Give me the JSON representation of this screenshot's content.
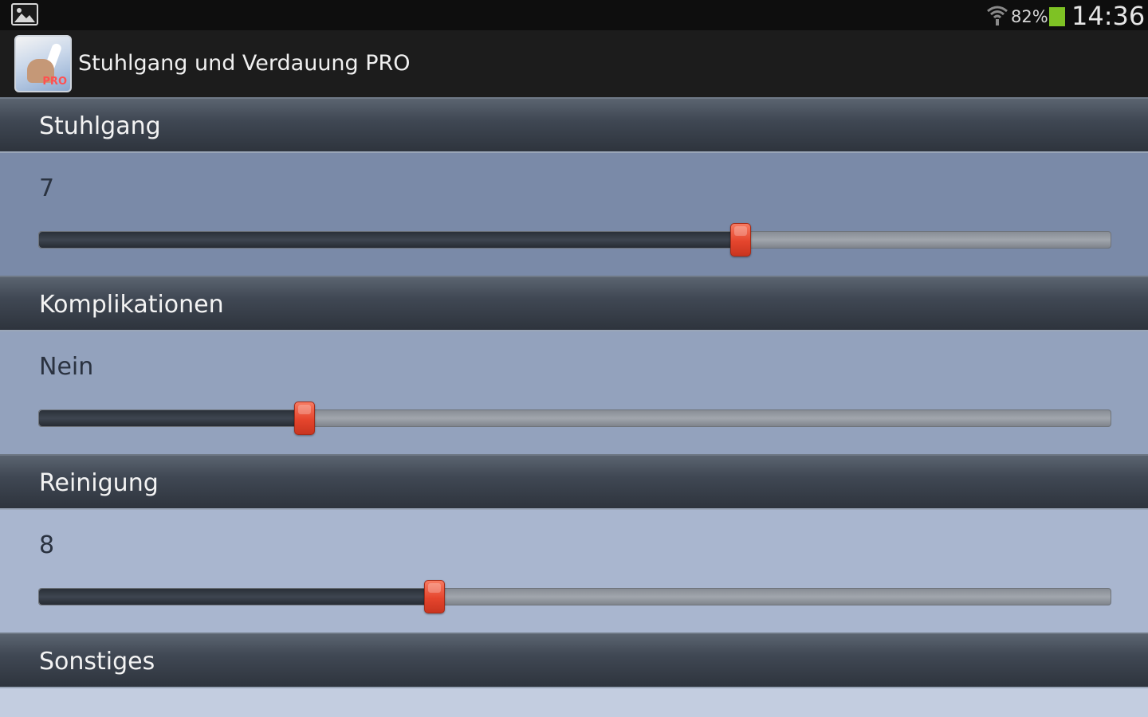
{
  "statusbar": {
    "battery_percent": "82%",
    "time": "14:36",
    "battery_color": "#7ec224"
  },
  "actionbar": {
    "app_title": "Stuhlgang und Verdauung PRO",
    "app_icon_badge": "PRO"
  },
  "sections": [
    {
      "title": "Stuhlgang",
      "value": "7",
      "level": 0.655,
      "panel_color": "#7a8aa8"
    },
    {
      "title": "Komplikationen",
      "value": "Nein",
      "level": 0.248,
      "panel_color": "#93a2bd"
    },
    {
      "title": "Reinigung",
      "value": "8",
      "level": 0.369,
      "panel_color": "#a9b6cf"
    },
    {
      "title": "Sonstiges",
      "value": "",
      "level": null,
      "panel_color": "#c3cde0"
    }
  ],
  "colors": {
    "thumb": "#e5452d",
    "header": "#3a414c"
  }
}
